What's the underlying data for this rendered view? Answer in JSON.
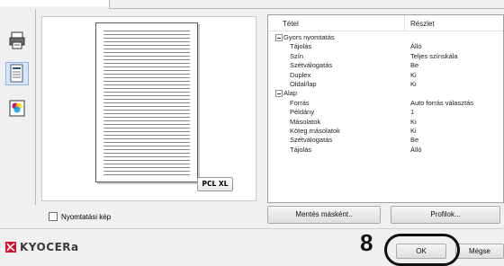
{
  "preview": {
    "pcl_label": "PCL XL"
  },
  "checkbox": {
    "label": "Nyomtatási kép",
    "checked": false
  },
  "side_icons": [
    "printer-icon",
    "document-page-icon",
    "color-palette-icon"
  ],
  "tree": {
    "col_item": "Tétel",
    "col_detail": "Részlet",
    "rows": [
      {
        "level": 0,
        "label": "Gyors nyomtatás",
        "value": ""
      },
      {
        "level": 1,
        "label": "Tájolás",
        "value": "Álló"
      },
      {
        "level": 1,
        "label": "Szín",
        "value": "Teljes színskála"
      },
      {
        "level": 1,
        "label": "Szétválogatás",
        "value": "Be"
      },
      {
        "level": 1,
        "label": "Duplex",
        "value": "Ki"
      },
      {
        "level": 1,
        "label": "Oldal/lap",
        "value": "Ki"
      },
      {
        "level": 0,
        "label": "Alap",
        "value": ""
      },
      {
        "level": 1,
        "label": "Forrás",
        "value": "Auto forrás választás"
      },
      {
        "level": 1,
        "label": "Példány",
        "value": "1"
      },
      {
        "level": 1,
        "label": "Másolatok",
        "value": "Ki"
      },
      {
        "level": 1,
        "label": "Köteg másolatok",
        "value": "Ki"
      },
      {
        "level": 1,
        "label": "Szétválogatás",
        "value": "Be"
      },
      {
        "level": 1,
        "label": "Tájolás",
        "value": "Álló"
      }
    ]
  },
  "buttons": {
    "save_as": "Mentés másként..",
    "profiles": "Profilok...",
    "ok": "OK",
    "cancel": "Mégse"
  },
  "brand": {
    "logo_text": "KYOCERa"
  },
  "annotation": {
    "step": "8"
  }
}
